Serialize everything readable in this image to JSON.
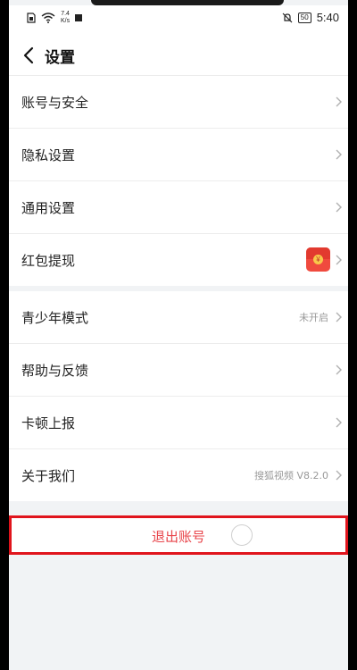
{
  "status_bar": {
    "speed": "7.4",
    "speed_unit": "K/s",
    "battery": "50",
    "time": "5:40"
  },
  "header": {
    "title": "设置"
  },
  "group1": [
    {
      "label": "账号与安全"
    },
    {
      "label": "隐私设置"
    },
    {
      "label": "通用设置"
    },
    {
      "label": "红包提现"
    }
  ],
  "group2": [
    {
      "label": "青少年模式",
      "value": "未开启"
    },
    {
      "label": "帮助与反馈"
    },
    {
      "label": "卡顿上报"
    },
    {
      "label": "关于我们",
      "value": "搜狐视频 V8.2.0"
    }
  ],
  "logout": {
    "label": "退出账号"
  },
  "colors": {
    "accent_red": "#e8454b",
    "highlight_border": "#e0141c",
    "red_packet": "#f04a3e"
  }
}
